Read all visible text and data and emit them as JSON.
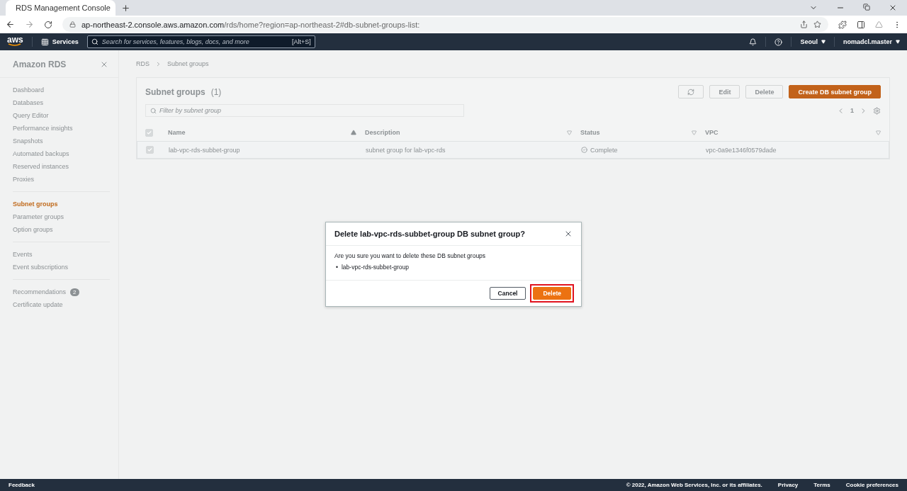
{
  "browser": {
    "tabs": [
      {
        "title": "RDS Management Console",
        "selected": true
      }
    ],
    "url_host": "ap-northeast-2.console.aws.amazon.com",
    "url_path": "/rds/home?region=ap-northeast-2#db-subnet-groups-list:"
  },
  "top_nav": {
    "logo_text": "aws",
    "services": "Services",
    "search": {
      "placeholder": "Search for services, features, blogs, docs, and more",
      "shortcut": "[Alt+S]"
    },
    "region": "Seoul",
    "account": "nomadcl.master"
  },
  "sidebar": {
    "title": "Amazon RDS",
    "sections": [
      [
        {
          "label": "Dashboard",
          "selected": false
        },
        {
          "label": "Databases",
          "selected": false
        },
        {
          "label": "Query Editor",
          "selected": false
        },
        {
          "label": "Performance insights",
          "selected": false
        },
        {
          "label": "Snapshots",
          "selected": false
        },
        {
          "label": "Automated backups",
          "selected": false
        },
        {
          "label": "Reserved instances",
          "selected": false
        },
        {
          "label": "Proxies",
          "selected": false
        }
      ],
      [
        {
          "label": "Subnet groups",
          "selected": true
        },
        {
          "label": "Parameter groups",
          "selected": false
        },
        {
          "label": "Option groups",
          "selected": false
        }
      ],
      [
        {
          "label": "Events",
          "selected": false
        },
        {
          "label": "Event subscriptions",
          "selected": false
        }
      ],
      [
        {
          "label": "Recommendations",
          "selected": false,
          "badge": "2"
        },
        {
          "label": "Certificate update",
          "selected": false
        }
      ]
    ]
  },
  "breadcrumbs": [
    "RDS",
    "Subnet groups"
  ],
  "panel": {
    "title": "Subnet groups",
    "count": "(1)",
    "buttons": [
      {
        "label": "Edit",
        "kind": "normal"
      },
      {
        "label": "Delete",
        "kind": "normal"
      },
      {
        "label": "Create DB subnet group",
        "kind": "primary"
      }
    ],
    "filter": {
      "placeholder": "Filter by subnet group"
    },
    "page": "1",
    "table": {
      "all_checked": true,
      "columns": [
        {
          "label": "Name",
          "sorted": true
        },
        {
          "label": "Description",
          "sorted": false
        },
        {
          "label": "Status",
          "sorted": false
        },
        {
          "label": "VPC",
          "sorted": false
        }
      ],
      "rows": [
        {
          "selected": true,
          "cells": [
            "lab-vpc-rds-subbet-group",
            "subnet group for lab-vpc-rds",
            "Complete",
            "vpc-0a9e1346f0579dade"
          ]
        }
      ]
    }
  },
  "modal": {
    "title": "Delete lab-vpc-rds-subbet-group DB subnet group?",
    "message": "Are you sure you want to delete these DB subnet groups",
    "items": [
      {
        "marker": "•",
        "text": "lab-vpc-rds-subbet-group"
      }
    ],
    "cancel": "Cancel",
    "confirm": {
      "label": "Delete",
      "highlighted": true
    }
  },
  "footer": {
    "feedback": "Feedback",
    "copyright": "© 2022, Amazon Web Services, Inc. or its affiliates.",
    "links": [
      "Privacy",
      "Terms",
      "Cookie preferences"
    ]
  }
}
